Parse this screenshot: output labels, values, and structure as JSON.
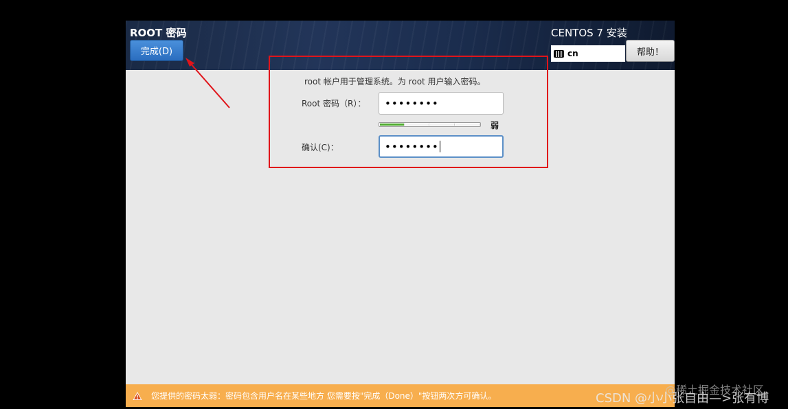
{
  "header": {
    "title": "ROOT 密码",
    "done_button": "完成(D)",
    "install_title": "CENTOS 7 安装",
    "keyboard_layout": "cn",
    "help_button": "帮助！"
  },
  "form": {
    "hint": "root 帐户用于管理系统。为 root 用户输入密码。",
    "password_label": "Root 密码（R）：",
    "password_value": "••••••••",
    "confirm_label": "确认(C)：",
    "confirm_value": "••••••••",
    "strength_label": "弱",
    "strength_fraction": 0.25
  },
  "warning": {
    "text": "您提供的密码太弱：密码包含用户名在某些地方 您需要按\"完成（Done）\"按钮两次方可确认。"
  },
  "watermarks": {
    "juejin": "@稀土掘金技术社区",
    "csdn": "CSDN @小小张自由—>张有博"
  },
  "colors": {
    "header_bg": "#1f3152",
    "done_button": "#3579cc",
    "warning_bar": "#f7ae4e",
    "annotation": "#e0141a",
    "strength_fill": "#4caa2c"
  }
}
